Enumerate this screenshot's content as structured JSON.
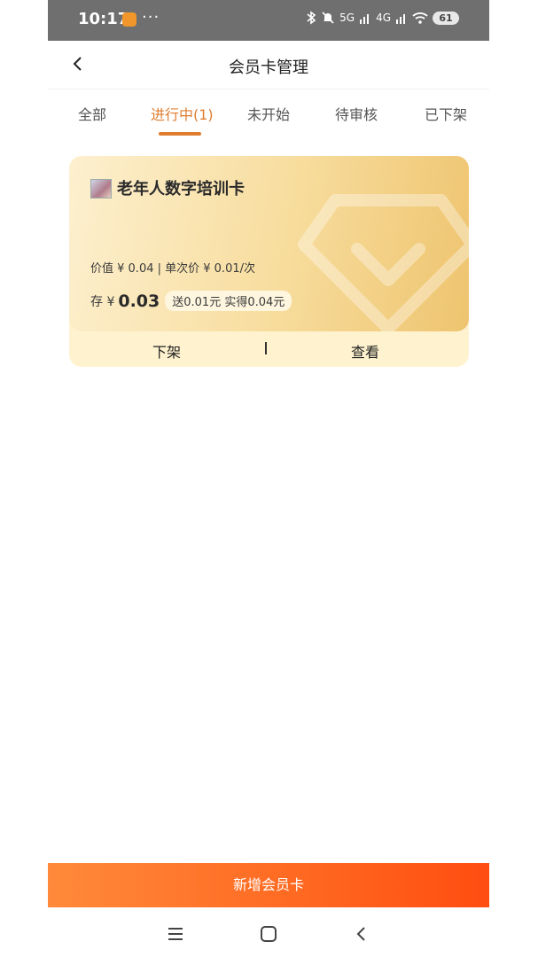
{
  "status_bar": {
    "time": "10:17",
    "dots": "···",
    "network_5g": "5G",
    "network_4g": "4G",
    "battery": "61"
  },
  "header": {
    "title": "会员卡管理"
  },
  "tabs": [
    {
      "label": "全部",
      "active": false
    },
    {
      "label": "进行中(1)",
      "active": true
    },
    {
      "label": "未开始",
      "active": false
    },
    {
      "label": "待审核",
      "active": false
    },
    {
      "label": "已下架",
      "active": false
    }
  ],
  "card": {
    "title": "老年人数字培训卡",
    "price_line": "价值 ¥ 0.04 | 单次价 ¥ 0.01/次",
    "deposit_label": "存 ¥",
    "deposit_value": "0.03",
    "bonus": "送0.01元 实得0.04元",
    "actions": {
      "delist": "下架",
      "view": "查看"
    }
  },
  "bottom_button": {
    "label": "新增会员卡"
  },
  "colors": {
    "accent": "#e07d2f",
    "button_start": "#ff8a3a",
    "button_end": "#ff4d10"
  }
}
